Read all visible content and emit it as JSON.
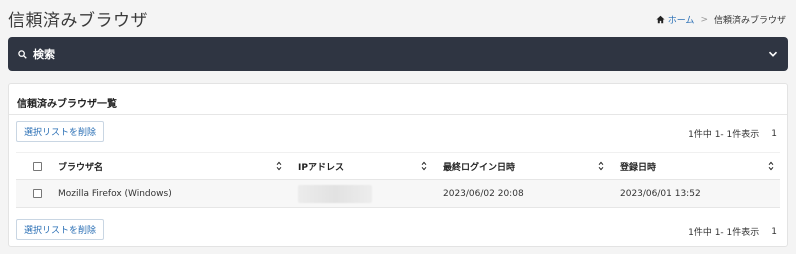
{
  "page": {
    "title": "信頼済みブラウザ"
  },
  "breadcrumb": {
    "home": "ホーム",
    "separator": ">",
    "current": "信頼済みブラウザ"
  },
  "search": {
    "label": "検索"
  },
  "card": {
    "title": "信頼済みブラウザ一覧"
  },
  "actions": {
    "delete_selected": "選択リストを削除"
  },
  "pager": {
    "summary": "1件中 1- 1件表示",
    "page": "1"
  },
  "table": {
    "columns": [
      "ブラウザ名",
      "IPアドレス",
      "最終ログイン日時",
      "登録日時"
    ],
    "rows": [
      {
        "browser": "Mozilla Firefox (Windows)",
        "ip": "",
        "last_login": "2023/06/02 20:08",
        "registered": "2023/06/01 13:52"
      }
    ]
  }
}
